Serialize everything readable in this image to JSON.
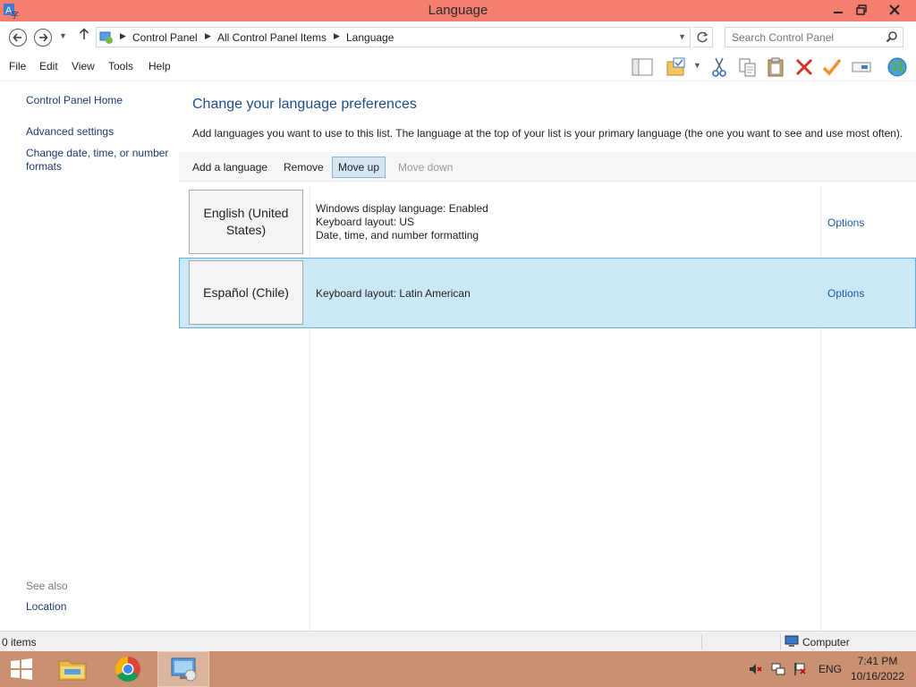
{
  "window": {
    "title": "Language"
  },
  "address": {
    "crumbs": [
      "Control Panel",
      "All Control Panel Items",
      "Language"
    ],
    "search_placeholder": "Search Control Panel"
  },
  "menu": [
    "File",
    "Edit",
    "View",
    "Tools",
    "Help"
  ],
  "toolbar_icons": [
    "layout-pane-icon",
    "folder-properties-icon",
    "cut-icon",
    "copy-icon",
    "paste-icon",
    "delete-icon",
    "check-icon",
    "rename-icon",
    "globe-icon"
  ],
  "left_pane": {
    "home": "Control Panel Home",
    "advanced": "Advanced settings",
    "date_time_1": "Change date, time, or number",
    "date_time_2": "formats",
    "see_also": "See also",
    "location": "Location"
  },
  "main": {
    "title": "Change your language preferences",
    "description": "Add languages you want to use to this list. The language at the top of your list is your primary language (the one you want to see and use most often).",
    "commands": {
      "add": "Add a language",
      "remove": "Remove",
      "move_up": "Move up",
      "move_down": "Move down"
    },
    "languages": [
      {
        "name_line1": "English (United",
        "name_line2": "States)",
        "details": [
          "Windows display language: Enabled",
          "Keyboard layout: US",
          "Date, time, and number formatting"
        ],
        "options": "Options",
        "selected": false
      },
      {
        "name_line1": "Español (Chile)",
        "name_line2": "",
        "details": [
          "Keyboard layout: Latin American"
        ],
        "options": "Options",
        "selected": true
      }
    ]
  },
  "status": {
    "items": "0 items",
    "location": "Computer"
  },
  "taskbar": {
    "apps": [
      "start-icon",
      "file-explorer-icon",
      "chrome-icon",
      "control-panel-icon"
    ],
    "input_lang": "ENG",
    "time": "7:41 PM",
    "date": "10/16/2022"
  },
  "colors": {
    "titlebar": "#f47f6f",
    "taskbar": "#c99071",
    "selection": "#cbe8f6",
    "link": "#1e5aa8"
  }
}
